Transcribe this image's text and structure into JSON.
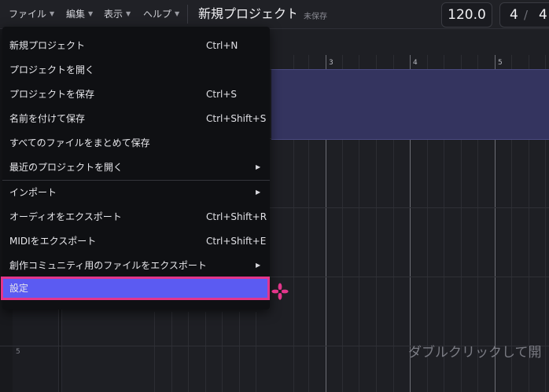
{
  "menubar": {
    "file": "ファイル",
    "edit": "編集",
    "view": "表示",
    "help": "ヘルプ"
  },
  "project": {
    "title": "新規プロジェクト",
    "status": "未保存"
  },
  "transport": {
    "tempo": "120.0",
    "ts_numerator": "4",
    "ts_separator": "/",
    "ts_denominator": "4"
  },
  "ruler": {
    "bars": [
      "3",
      "4",
      "5"
    ]
  },
  "track": {
    "row_number": "5"
  },
  "editor": {
    "hint": "ダブルクリックして開"
  },
  "file_menu": {
    "items": [
      {
        "label": "新規プロジェクト",
        "shortcut": "Ctrl+N"
      },
      {
        "label": "プロジェクトを開く",
        "shortcut": ""
      },
      {
        "label": "プロジェクトを保存",
        "shortcut": "Ctrl+S"
      },
      {
        "label": "名前を付けて保存",
        "shortcut": "Ctrl+Shift+S"
      },
      {
        "label": "すべてのファイルをまとめて保存",
        "shortcut": ""
      },
      {
        "label": "最近のプロジェクトを開く",
        "shortcut": "",
        "submenu": true
      },
      {
        "label": "インポート",
        "shortcut": "",
        "submenu": true
      },
      {
        "label": "オーディオをエクスポート",
        "shortcut": "Ctrl+Shift+R"
      },
      {
        "label": "MIDIをエクスポート",
        "shortcut": "Ctrl+Shift+E"
      },
      {
        "label": "創作コミュニティ用のファイルをエクスポート",
        "shortcut": "",
        "submenu": true
      },
      {
        "label": "設定",
        "shortcut": "",
        "selected": true
      }
    ]
  },
  "colors": {
    "highlight": "#5b5bf2",
    "highlight_border": "#e3368b",
    "track_band": "#34345f"
  }
}
